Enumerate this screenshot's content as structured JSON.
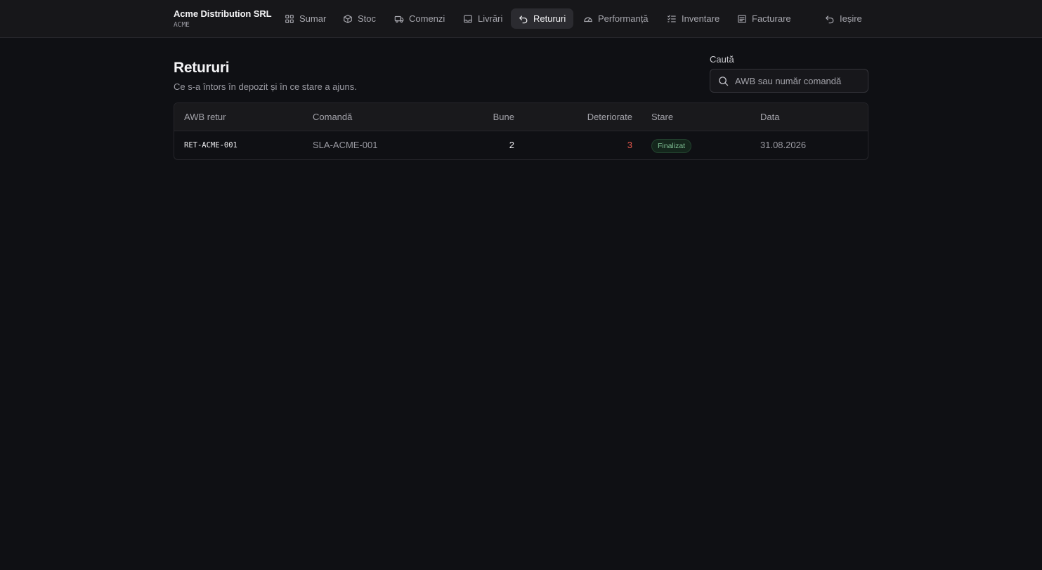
{
  "brand": {
    "name": "Acme Distribution SRL",
    "code": "ACME"
  },
  "nav": {
    "items": [
      {
        "label": "Sumar",
        "icon": "grid-icon"
      },
      {
        "label": "Stoc",
        "icon": "box-icon"
      },
      {
        "label": "Comenzi",
        "icon": "truck-icon"
      },
      {
        "label": "Livrări",
        "icon": "inbox-icon"
      },
      {
        "label": "Retururi",
        "icon": "undo-icon",
        "active": true
      },
      {
        "label": "Performanță",
        "icon": "gauge-icon"
      },
      {
        "label": "Inventare",
        "icon": "checklist-icon"
      },
      {
        "label": "Facturare",
        "icon": "receipt-icon"
      }
    ],
    "logout": {
      "label": "Ieșire",
      "icon": "logout-icon"
    }
  },
  "page": {
    "title": "Retururi",
    "subtitle": "Ce s-a întors în depozit și în ce stare a ajuns."
  },
  "search": {
    "label": "Caută",
    "placeholder": "AWB sau număr comandă",
    "value": ""
  },
  "table": {
    "columns": [
      "AWB retur",
      "Comandă",
      "Bune",
      "Deteriorate",
      "Stare",
      "Data"
    ],
    "rows": [
      {
        "awb": "RET-ACME-001",
        "order": "SLA-ACME-001",
        "good": "2",
        "damaged": "3",
        "status": "Finalizat",
        "date": "31.08.2026"
      }
    ]
  },
  "colors": {
    "background": "#0f1014",
    "topbar": "#17171a",
    "accent_active": "#2b2b30",
    "damaged": "#e4574b",
    "status_done": "#7fbf94"
  }
}
